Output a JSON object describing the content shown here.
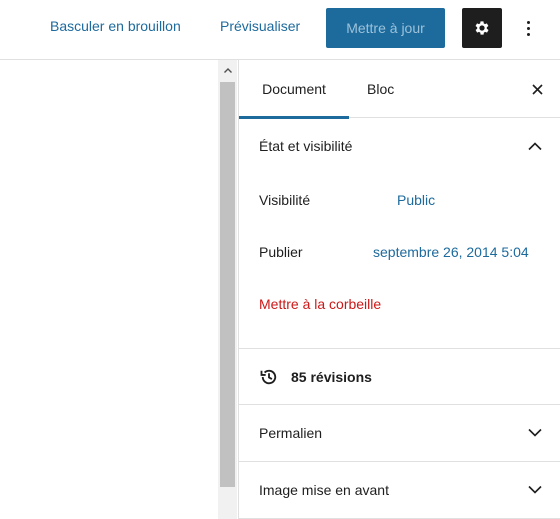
{
  "toolbar": {
    "switch_draft_label": "Basculer en brouillon",
    "preview_label": "Prévisualiser",
    "update_label": "Mettre à jour",
    "settings_icon": "gear-icon",
    "more_icon": "vertical-ellipsis-icon"
  },
  "sidebar": {
    "tabs": [
      {
        "label": "Document",
        "active": true
      },
      {
        "label": "Bloc",
        "active": false
      }
    ],
    "close_icon": "close-icon",
    "status_panel": {
      "title": "État et visibilité",
      "expanded": true,
      "visibility_label": "Visibilité",
      "visibility_value": "Public",
      "publish_label": "Publier",
      "publish_value": "septembre 26, 2014 5:04",
      "trash_label": "Mettre à la corbeille"
    },
    "revisions": {
      "icon": "history-icon",
      "label": "85 révisions"
    },
    "permalink_panel": {
      "title": "Permalien",
      "expanded": false
    },
    "featured_image_panel": {
      "title": "Image mise en avant",
      "expanded": false
    }
  },
  "colors": {
    "accent": "#1d6a9c",
    "danger": "#cc1818",
    "text": "#1e1e1e",
    "border": "#e0e0e0"
  }
}
